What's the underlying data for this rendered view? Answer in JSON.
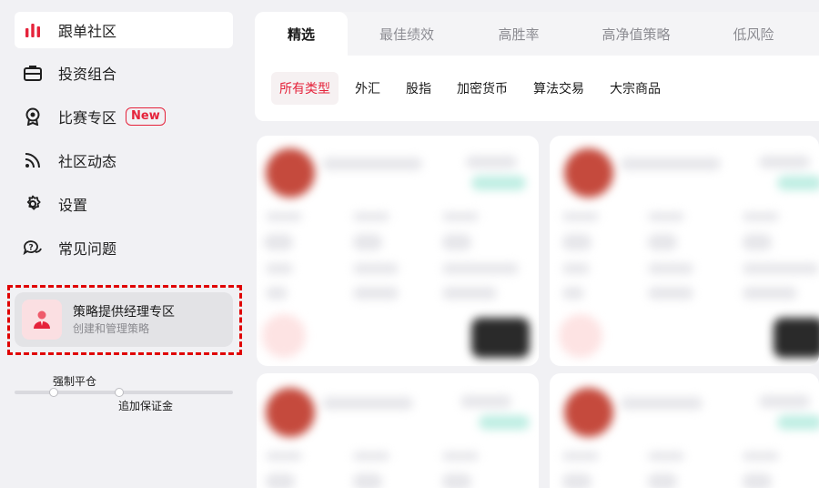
{
  "sidebar": {
    "items": [
      {
        "label": "跟单社区",
        "icon": "bar-chart-icon"
      },
      {
        "label": "投资组合",
        "icon": "briefcase-icon"
      },
      {
        "label": "比赛专区",
        "icon": "medal-icon",
        "badge": "New"
      },
      {
        "label": "社区动态",
        "icon": "rss-icon"
      },
      {
        "label": "设置",
        "icon": "gear-icon"
      },
      {
        "label": "常见问题",
        "icon": "chat-question-icon"
      }
    ],
    "promo": {
      "title": "策略提供经理专区",
      "subtitle": "创建和管理策略"
    },
    "slider": {
      "label_top": "强制平仓",
      "label_bottom": "追加保证金"
    }
  },
  "main": {
    "tabs": [
      "精选",
      "最佳绩效",
      "高胜率",
      "高净值策略",
      "低风险"
    ],
    "filters": [
      "所有类型",
      "外汇",
      "股指",
      "加密货币",
      "算法交易",
      "大宗商品"
    ]
  },
  "colors": {
    "accent": "#e5233b",
    "highlight_outline": "#e00000"
  }
}
